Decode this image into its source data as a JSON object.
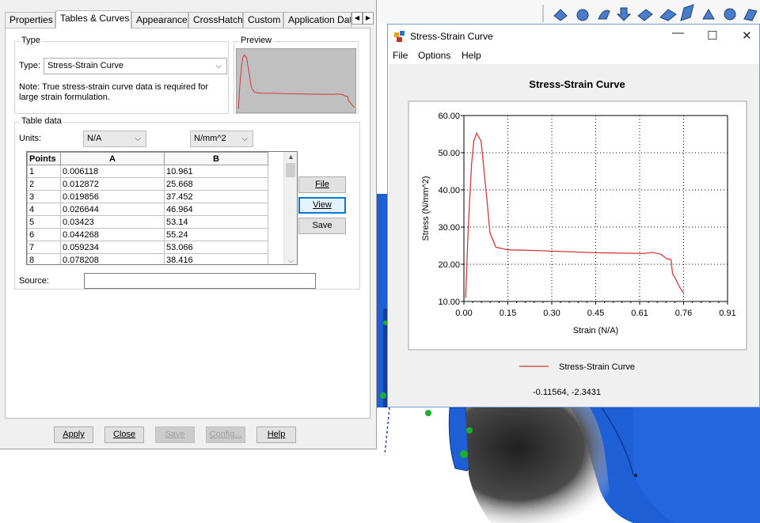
{
  "colors": {
    "cad_blue": "#1f5fd6",
    "curve_red": "#d03a3a",
    "focus_blue": "#0078d7"
  },
  "dialog": {
    "tabs": [
      {
        "label": "Properties",
        "active": false
      },
      {
        "label": "Tables & Curves",
        "active": true
      },
      {
        "label": "Appearance",
        "active": false
      },
      {
        "label": "CrossHatch",
        "active": false
      },
      {
        "label": "Custom",
        "active": false
      },
      {
        "label": "Application Dat",
        "active": false
      }
    ],
    "type_group": {
      "title": "Type",
      "type_label": "Type:",
      "type_value": "Stress-Strain Curve",
      "note": "Note: True stress-strain curve data is required for large strain formulation.",
      "note_line1": "Note: True stress-strain curve data is required for",
      "note_line2": "large strain formulation."
    },
    "preview": {
      "title": "Preview"
    },
    "table_group": {
      "title": "Table data",
      "units_label": "Units:",
      "unit_a": "N/A",
      "unit_b": "N/mm^2",
      "headers": [
        "Points",
        "A",
        "B"
      ],
      "rows": [
        [
          "1",
          "0.006118",
          "10.961"
        ],
        [
          "2",
          "0.012872",
          "25.668"
        ],
        [
          "3",
          "0.019856",
          "37.452"
        ],
        [
          "4",
          "0.026644",
          "46.964"
        ],
        [
          "5",
          "0.03423",
          "53.14"
        ],
        [
          "6",
          "0.044268",
          "55.24"
        ],
        [
          "7",
          "0.059234",
          "53.066"
        ],
        [
          "8",
          "0.078208",
          "38.416"
        ]
      ],
      "file_button": "File",
      "view_button": "View",
      "save_button": "Save",
      "source_label": "Source:",
      "source_value": ""
    },
    "footer": {
      "apply": "Apply",
      "close": "Close",
      "save": "Save",
      "config": "Config...",
      "help": "Help"
    }
  },
  "curve_window": {
    "title": "Stress-Strain Curve",
    "menu": [
      "File",
      "Options",
      "Help"
    ],
    "legend_label": "Stress-Strain Curve",
    "coordinates": "-0.11564, -2.3431"
  },
  "chart_data": {
    "type": "line",
    "title": "Stress-Strain Curve",
    "xlabel": "Strain (N/A)",
    "ylabel": "Stress (N/mm^2)",
    "xlim": [
      0,
      0.91
    ],
    "ylim": [
      10,
      60
    ],
    "x_ticks": [
      "0.00",
      "0.15",
      "0.30",
      "0.45",
      "0.61",
      "0.76",
      "0.91"
    ],
    "y_ticks": [
      "10.00",
      "20.00",
      "30.00",
      "40.00",
      "50.00",
      "60.00"
    ],
    "grid": true,
    "legend": "bottom",
    "series": [
      {
        "name": "Stress-Strain Curve",
        "x": [
          0.006118,
          0.012872,
          0.019856,
          0.026644,
          0.03423,
          0.044268,
          0.059234,
          0.078208,
          0.09,
          0.11,
          0.15,
          0.25,
          0.35,
          0.45,
          0.55,
          0.62,
          0.65,
          0.68,
          0.7,
          0.715,
          0.72,
          0.73,
          0.745,
          0.76
        ],
        "y": [
          10.961,
          25.668,
          37.452,
          46.964,
          53.14,
          55.24,
          53.066,
          38.416,
          28.5,
          24.6,
          23.9,
          23.7,
          23.4,
          23.1,
          23.0,
          22.9,
          23.2,
          22.7,
          21.5,
          21.3,
          17.5,
          16.2,
          13.8,
          12.0
        ]
      }
    ]
  }
}
